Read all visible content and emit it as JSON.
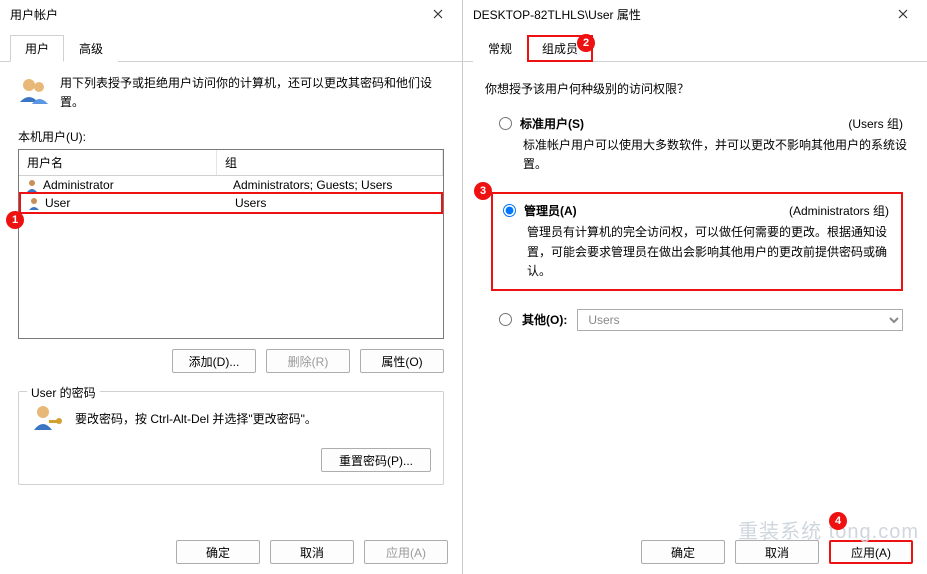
{
  "left": {
    "title": "用户帐户",
    "tabs": {
      "users": "用户",
      "advanced": "高级"
    },
    "intro": "用下列表授予或拒绝用户访问你的计算机，还可以更改其密码和他们设置。",
    "list_label": "本机用户(U):",
    "columns": {
      "name": "用户名",
      "group": "组"
    },
    "rows": [
      {
        "name": "Administrator",
        "group": "Administrators; Guests; Users"
      },
      {
        "name": "User",
        "group": "Users"
      }
    ],
    "buttons": {
      "add": "添加(D)...",
      "remove": "删除(R)",
      "props": "属性(O)"
    },
    "pwbox": {
      "title": "User 的密码",
      "text": "要改密码，按 Ctrl-Alt-Del 并选择\"更改密码\"。",
      "reset": "重置密码(P)..."
    },
    "bottom": {
      "ok": "确定",
      "cancel": "取消",
      "apply": "应用(A)"
    }
  },
  "right": {
    "title": "DESKTOP-82TLHLS\\User 属性",
    "tabs": {
      "general": "常规",
      "member": "组成员"
    },
    "question": "你想授予该用户何种级别的访问权限？",
    "std": {
      "label": "标准用户(S)",
      "group": "(Users 组)",
      "desc": "标准帐户用户可以使用大多数软件，并可以更改不影响其他用户的系统设置。"
    },
    "admin": {
      "label": "管理员(A)",
      "group": "(Administrators 组)",
      "desc": "管理员有计算机的完全访问权，可以做任何需要的更改。根据通知设置，可能会要求管理员在做出会影响其他用户的更改前提供密码或确认。"
    },
    "other": {
      "label": "其他(O):",
      "value": "Users"
    },
    "bottom": {
      "ok": "确定",
      "cancel": "取消",
      "apply": "应用(A)"
    }
  },
  "badges": {
    "b1": "1",
    "b2": "2",
    "b3": "3",
    "b4": "4"
  },
  "watermark": "重装系统 tong.com"
}
